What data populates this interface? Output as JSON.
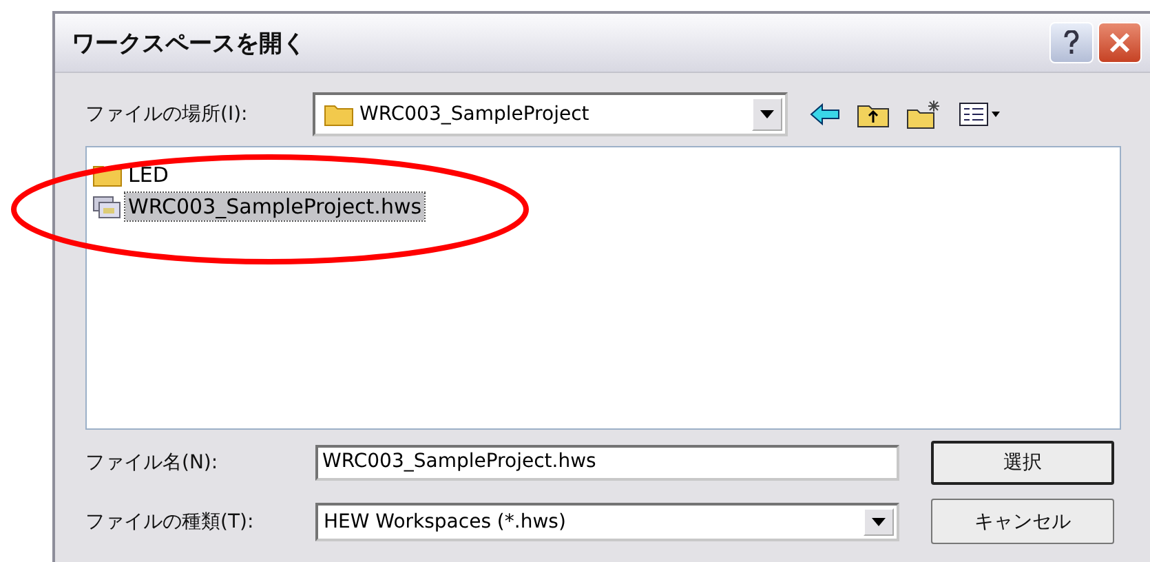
{
  "window": {
    "title": "ワークスペースを開く"
  },
  "location": {
    "label": "ファイルの場所(I):",
    "value": "WRC003_SampleProject"
  },
  "files": [
    {
      "name": "LED",
      "kind": "folder",
      "selected": false
    },
    {
      "name": "WRC003_SampleProject.hws",
      "kind": "workspace",
      "selected": true
    }
  ],
  "filename": {
    "label": "ファイル名(N):",
    "value": "WRC003_SampleProject.hws"
  },
  "filetype": {
    "label": "ファイルの種類(T):",
    "value": "HEW Workspaces (*.hws)"
  },
  "buttons": [
    "選択",
    "キャンセル"
  ]
}
